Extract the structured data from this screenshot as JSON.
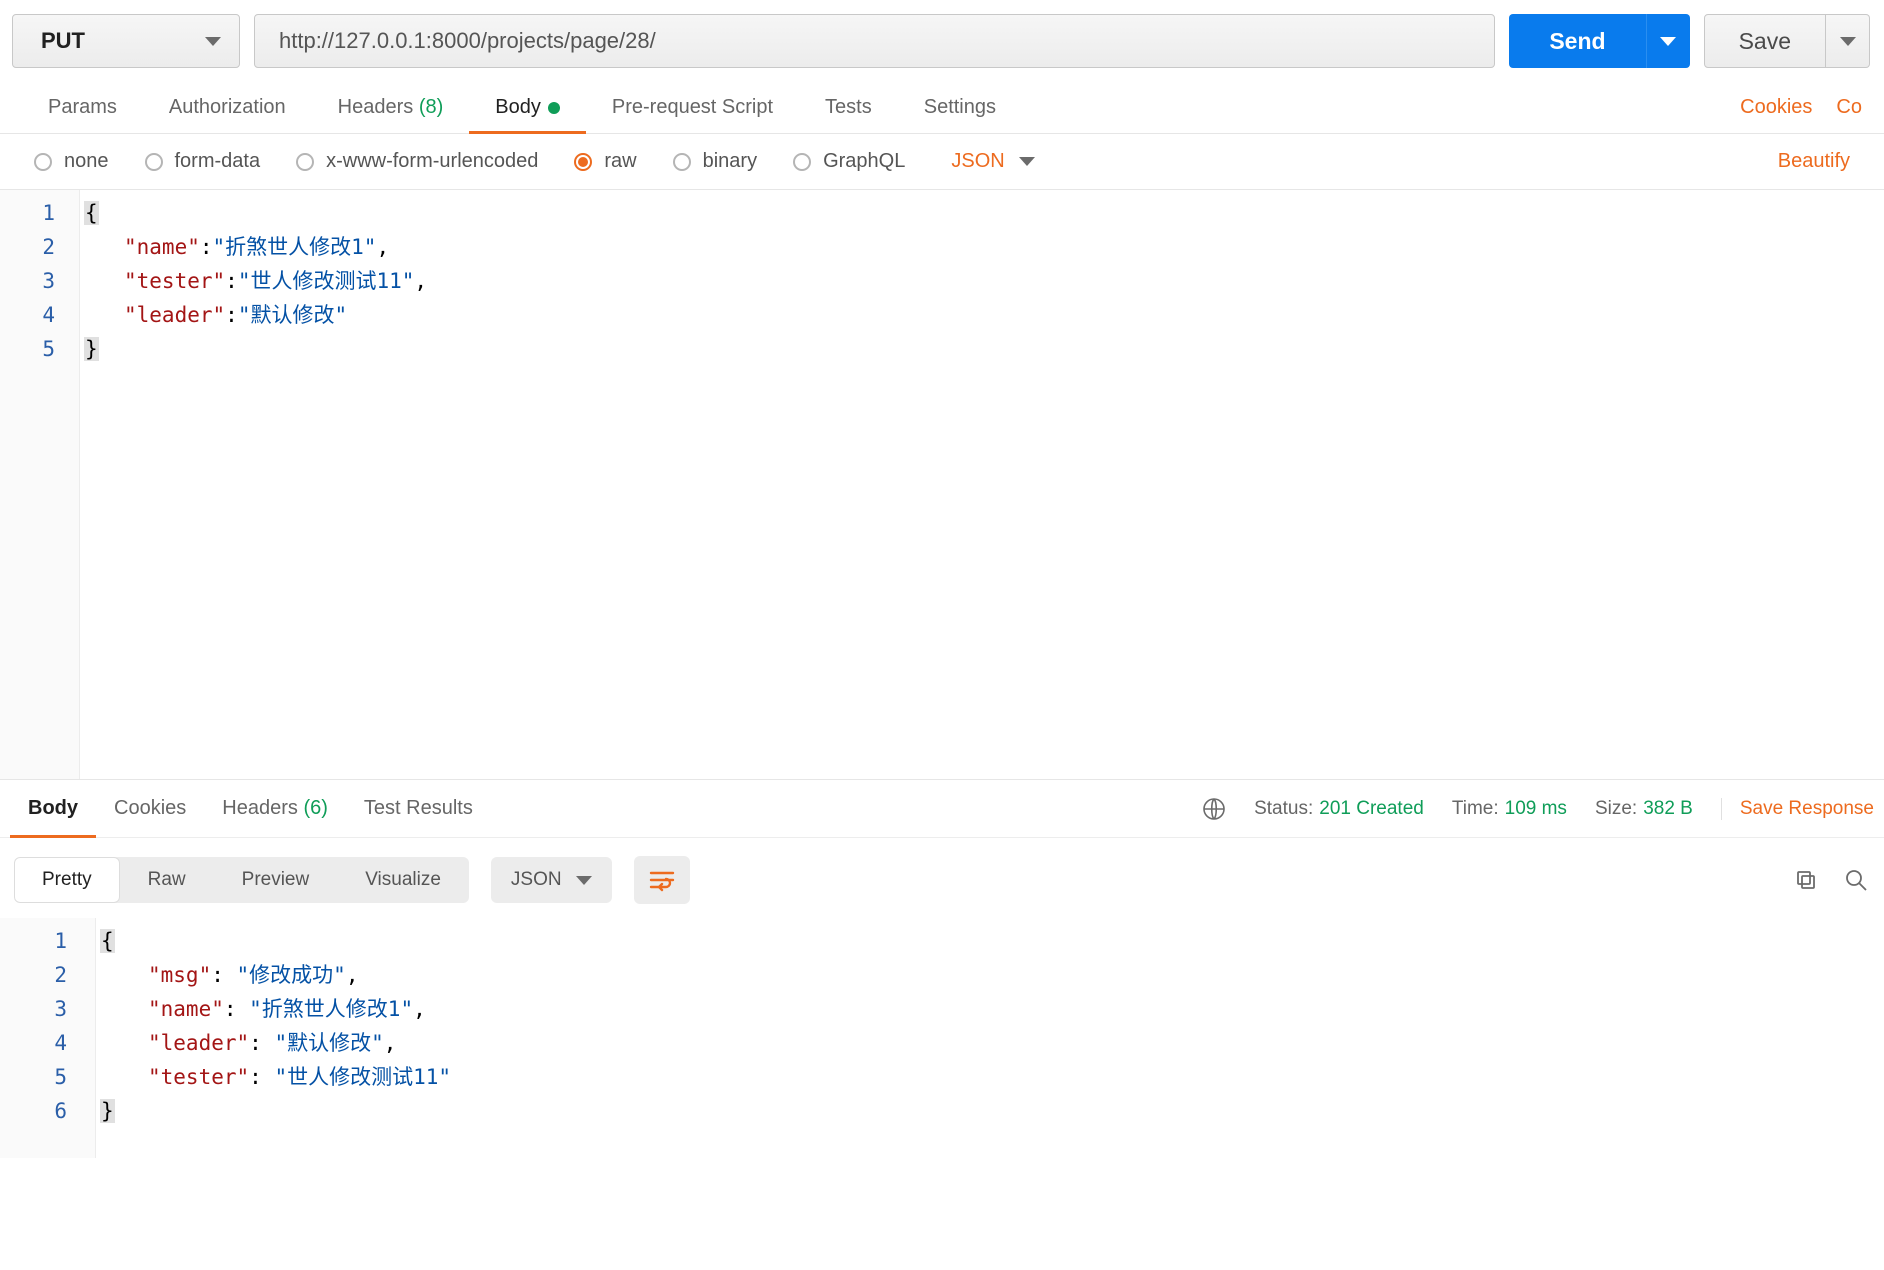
{
  "request": {
    "method": "PUT",
    "url": "http://127.0.0.1:8000/projects/page/28/",
    "send_label": "Send",
    "save_label": "Save"
  },
  "req_tabs": {
    "params": "Params",
    "authorization": "Authorization",
    "headers": "Headers",
    "headers_count": "(8)",
    "body": "Body",
    "prerequest": "Pre-request Script",
    "tests": "Tests",
    "settings": "Settings",
    "cookies": "Cookies",
    "code": "Co"
  },
  "body_types": {
    "none": "none",
    "formdata": "form-data",
    "xwww": "x-www-form-urlencoded",
    "raw": "raw",
    "binary": "binary",
    "graphql": "GraphQL",
    "format": "JSON",
    "beautify": "Beautify"
  },
  "request_body": {
    "line_numbers": [
      "1",
      "2",
      "3",
      "4",
      "5"
    ],
    "lines": [
      [
        {
          "t": "brace",
          "v": "{"
        }
      ],
      [
        {
          "t": "key",
          "v": "\"name\""
        },
        {
          "t": "colon",
          "v": ":"
        },
        {
          "t": "str",
          "v": "\"折煞世人修改1\""
        },
        {
          "t": "comma",
          "v": ","
        }
      ],
      [
        {
          "t": "key",
          "v": "\"tester\""
        },
        {
          "t": "colon",
          "v": ":"
        },
        {
          "t": "str",
          "v": "\"世人修改测试11\""
        },
        {
          "t": "comma",
          "v": ","
        }
      ],
      [
        {
          "t": "key",
          "v": "\"leader\""
        },
        {
          "t": "colon",
          "v": ":"
        },
        {
          "t": "str",
          "v": "\"默认修改\""
        }
      ],
      [
        {
          "t": "brace",
          "v": "}"
        }
      ]
    ]
  },
  "resp_tabs": {
    "body": "Body",
    "cookies": "Cookies",
    "headers": "Headers",
    "headers_count": "(6)",
    "test_results": "Test Results"
  },
  "resp_meta": {
    "status_label": "Status:",
    "status_value": "201 Created",
    "time_label": "Time:",
    "time_value": "109 ms",
    "size_label": "Size:",
    "size_value": "382 B",
    "save_response": "Save Response"
  },
  "resp_controls": {
    "pretty": "Pretty",
    "raw": "Raw",
    "preview": "Preview",
    "visualize": "Visualize",
    "format": "JSON"
  },
  "response_body": {
    "line_numbers": [
      "1",
      "2",
      "3",
      "4",
      "5",
      "6"
    ],
    "lines": [
      [
        {
          "t": "brace",
          "v": "{"
        }
      ],
      [
        {
          "t": "key",
          "v": "\"msg\""
        },
        {
          "t": "colon",
          "v": ": "
        },
        {
          "t": "str",
          "v": "\"修改成功\""
        },
        {
          "t": "comma",
          "v": ","
        }
      ],
      [
        {
          "t": "key",
          "v": "\"name\""
        },
        {
          "t": "colon",
          "v": ": "
        },
        {
          "t": "str",
          "v": "\"折煞世人修改1\""
        },
        {
          "t": "comma",
          "v": ","
        }
      ],
      [
        {
          "t": "key",
          "v": "\"leader\""
        },
        {
          "t": "colon",
          "v": ": "
        },
        {
          "t": "str",
          "v": "\"默认修改\""
        },
        {
          "t": "comma",
          "v": ","
        }
      ],
      [
        {
          "t": "key",
          "v": "\"tester\""
        },
        {
          "t": "colon",
          "v": ": "
        },
        {
          "t": "str",
          "v": "\"世人修改测试11\""
        }
      ],
      [
        {
          "t": "brace",
          "v": "}"
        }
      ]
    ]
  }
}
